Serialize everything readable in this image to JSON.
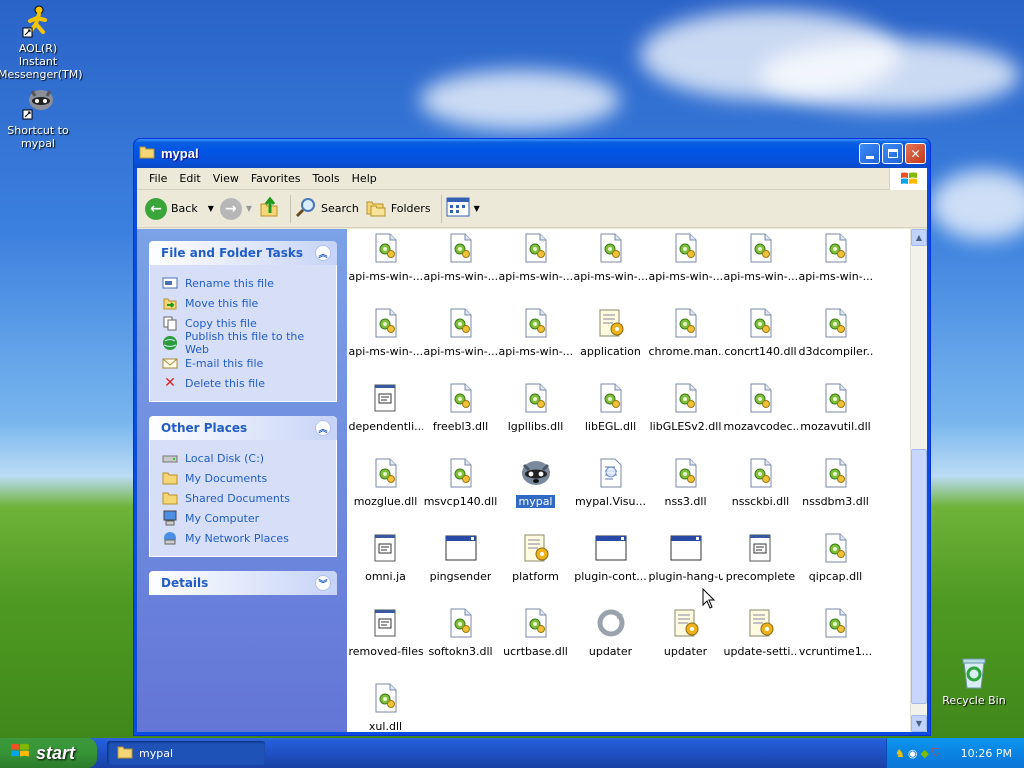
{
  "desktop": {
    "icons": [
      {
        "label": "AOL(R) Instant Messenger(TM)"
      },
      {
        "label": "Shortcut to mypal"
      },
      {
        "label": "Recycle Bin"
      }
    ]
  },
  "window": {
    "title": "mypal",
    "menu": [
      "File",
      "Edit",
      "View",
      "Favorites",
      "Tools",
      "Help"
    ],
    "toolbar": {
      "back": "Back",
      "search": "Search",
      "folders": "Folders"
    }
  },
  "taskpane": {
    "file_tasks": {
      "title": "File and Folder Tasks",
      "items": [
        "Rename this file",
        "Move this file",
        "Copy this file",
        "Publish this file to the Web",
        "E-mail this file",
        "Delete this file"
      ]
    },
    "other_places": {
      "title": "Other Places",
      "items": [
        "Local Disk (C:)",
        "My Documents",
        "Shared Documents",
        "My Computer",
        "My Network Places"
      ]
    },
    "details": {
      "title": "Details"
    }
  },
  "files": [
    {
      "name": "api-ms-win-...",
      "kind": "dll"
    },
    {
      "name": "api-ms-win-...",
      "kind": "dll"
    },
    {
      "name": "api-ms-win-...",
      "kind": "dll"
    },
    {
      "name": "api-ms-win-...",
      "kind": "dll"
    },
    {
      "name": "api-ms-win-...",
      "kind": "dll"
    },
    {
      "name": "api-ms-win-...",
      "kind": "dll"
    },
    {
      "name": "api-ms-win-...",
      "kind": "dll"
    },
    {
      "name": "api-ms-win-...",
      "kind": "dll"
    },
    {
      "name": "api-ms-win-...",
      "kind": "dll"
    },
    {
      "name": "api-ms-win-...",
      "kind": "dll"
    },
    {
      "name": "application",
      "kind": "ini"
    },
    {
      "name": "chrome.man...",
      "kind": "dll"
    },
    {
      "name": "concrt140.dll",
      "kind": "dll"
    },
    {
      "name": "d3dcompiler...",
      "kind": "dll"
    },
    {
      "name": "dependentli...",
      "kind": "doc"
    },
    {
      "name": "freebl3.dll",
      "kind": "dll"
    },
    {
      "name": "lgpllibs.dll",
      "kind": "dll"
    },
    {
      "name": "libEGL.dll",
      "kind": "dll"
    },
    {
      "name": "libGLESv2.dll",
      "kind": "dll"
    },
    {
      "name": "mozavcodec...",
      "kind": "dll"
    },
    {
      "name": "mozavutil.dll",
      "kind": "dll"
    },
    {
      "name": "mozglue.dll",
      "kind": "dll"
    },
    {
      "name": "msvcp140.dll",
      "kind": "dll"
    },
    {
      "name": "mypal",
      "kind": "app",
      "selected": true
    },
    {
      "name": "mypal.Visu...",
      "kind": "manifest"
    },
    {
      "name": "nss3.dll",
      "kind": "dll"
    },
    {
      "name": "nssckbi.dll",
      "kind": "dll"
    },
    {
      "name": "nssdbm3.dll",
      "kind": "dll"
    },
    {
      "name": "omni.ja",
      "kind": "doc"
    },
    {
      "name": "pingsender",
      "kind": "exe"
    },
    {
      "name": "platform",
      "kind": "ini"
    },
    {
      "name": "plugin-cont...",
      "kind": "exe"
    },
    {
      "name": "plugin-hang-ui",
      "kind": "exe"
    },
    {
      "name": "precomplete",
      "kind": "doc"
    },
    {
      "name": "qipcap.dll",
      "kind": "dll"
    },
    {
      "name": "removed-files",
      "kind": "doc"
    },
    {
      "name": "softokn3.dll",
      "kind": "dll"
    },
    {
      "name": "ucrtbase.dll",
      "kind": "dll"
    },
    {
      "name": "updater",
      "kind": "updater"
    },
    {
      "name": "updater",
      "kind": "ini"
    },
    {
      "name": "update-setti...",
      "kind": "ini"
    },
    {
      "name": "vcruntime1...",
      "kind": "dll"
    },
    {
      "name": "xul.dll",
      "kind": "dll"
    }
  ],
  "taskbar": {
    "start_label": "start",
    "task": "mypal",
    "clock": "10:26 PM"
  }
}
